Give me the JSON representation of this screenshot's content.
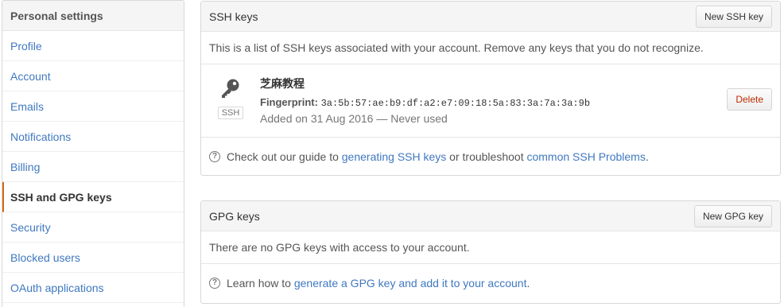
{
  "sidebar": {
    "title": "Personal settings",
    "items": [
      {
        "label": "Profile"
      },
      {
        "label": "Account"
      },
      {
        "label": "Emails"
      },
      {
        "label": "Notifications"
      },
      {
        "label": "Billing"
      },
      {
        "label": "SSH and GPG keys",
        "selected": true
      },
      {
        "label": "Security"
      },
      {
        "label": "Blocked users"
      },
      {
        "label": "OAuth applications"
      }
    ]
  },
  "ssh": {
    "title": "SSH keys",
    "new_button": "New SSH key",
    "description": "This is a list of SSH keys associated with your account. Remove any keys that you do not recognize.",
    "key": {
      "icon": "key-icon",
      "type_label": "SSH",
      "title": "芝麻教程",
      "fingerprint_label": "Fingerprint:",
      "fingerprint": "3a:5b:57:ae:b9:df:a2:e7:09:18:5a:83:3a:7a:3a:9b",
      "added": "Added on 31 Aug 2016 — Never used",
      "delete_label": "Delete"
    },
    "help": {
      "prefix": "Check out our guide to ",
      "link1": "generating SSH keys",
      "middle": " or troubleshoot ",
      "link2": "common SSH Problems",
      "suffix": "."
    }
  },
  "gpg": {
    "title": "GPG keys",
    "new_button": "New GPG key",
    "description": "There are no GPG keys with access to your account.",
    "help": {
      "prefix": "Learn how to ",
      "link": "generate a GPG key and add it to your account",
      "suffix": "."
    }
  },
  "colors": {
    "link": "#4078c0",
    "selected_border": "#d26911",
    "danger": "#bd2c00"
  }
}
